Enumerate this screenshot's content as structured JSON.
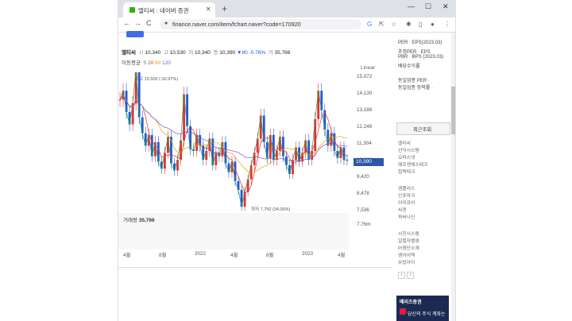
{
  "browser": {
    "tab_title": "엘티씨 : 네이버 증권",
    "tab_close": "✕",
    "new_tab": "+",
    "window_min": "—",
    "window_max": "☐",
    "window_close": "✕",
    "url": "finance.naver.com/item/fchart.naver?code=170920",
    "nav_back": "←",
    "nav_forward": "→",
    "nav_reload": "C",
    "lock_icon": "🔒"
  },
  "quote": {
    "name": "엘티씨",
    "open_label": "시",
    "open_value": "10,340",
    "high_label": "고",
    "high_value": "10,530",
    "low_label": "저",
    "low_value": "10,340",
    "close_label": "종",
    "close_value": "10,390",
    "change_arrow": "▼",
    "change_value": "80",
    "change_pct": "-0.76%",
    "volume_label": "거",
    "volume_value": "35,766"
  },
  "ma": {
    "label": "이동평균",
    "periods": [
      "5",
      "20",
      "60",
      "120"
    ],
    "colors": [
      "#2aa14a",
      "#e03131",
      "#e5a000",
      "#7a54c8"
    ]
  },
  "scale_mode": "Linear",
  "chart_data": {
    "type": "line",
    "title": "",
    "y_ticks": [
      "15,072",
      "14,130",
      "13,188",
      "12,246",
      "11,304",
      "10,362",
      "9,420",
      "8,478",
      "7,536"
    ],
    "x_ticks": [
      "4월",
      "8월",
      "2022",
      "4월",
      "8월",
      "2023",
      "4월"
    ],
    "current_price": "10,390",
    "high_annotation": "최고 15,500 (-32.97%)",
    "low_annotation": "최저 7,750 (34.06%)",
    "ylim": [
      7536,
      15072
    ],
    "close_series": [
      13800,
      14300,
      13100,
      12400,
      13600,
      15500,
      12800,
      11900,
      11200,
      11800,
      10600,
      11400,
      10300,
      9900,
      10800,
      11700,
      10200,
      9800,
      10400,
      11500,
      14100,
      12300,
      11000,
      10900,
      11800,
      11200,
      10400,
      10900,
      11600,
      10100,
      10800,
      10600,
      11400,
      10200,
      9700,
      10300,
      9200,
      8700,
      7750,
      8600,
      9300,
      10100,
      10800,
      11600,
      12900,
      11400,
      10500,
      11800,
      10400,
      10900,
      11700,
      10600,
      10100,
      9600,
      10400,
      11100,
      10300,
      10800,
      11500,
      10400,
      10900,
      12700,
      14300,
      13200,
      12100,
      11200,
      11900,
      10900,
      10500,
      11100,
      10400,
      10390
    ],
    "volume_label": "거래량",
    "volume_value": "35,766",
    "volume_axis": "7.76m"
  },
  "right_panel": {
    "rows": [
      "PER · EPS(2023.03)",
      "추정PER · EPS",
      "PBR · BPS (2023.03)",
      "배당수익률"
    ],
    "industry_rows": [
      "동일업종 PER ·",
      "동일업종 등락률 ·"
    ],
    "recent_tab": "최근조회",
    "recent_items": [
      "엘티씨",
      "선익시스템",
      "오파스넷",
      "에프엔에스테크",
      "칩텍테크"
    ],
    "recent_items2": [
      "엠플러스",
      "인포마크",
      "이미큐어",
      "씨젠",
      "파버나인"
    ],
    "recent_items3": [
      "서진시스템",
      "일렬자벨엠",
      "PI첨단소재",
      "엠아이텍",
      "유탑아이"
    ],
    "pager_prev": "‹",
    "pager_next": "›",
    "ad_brand": "메리츠증권",
    "ad_text": "당신의 주식 계좌는"
  }
}
